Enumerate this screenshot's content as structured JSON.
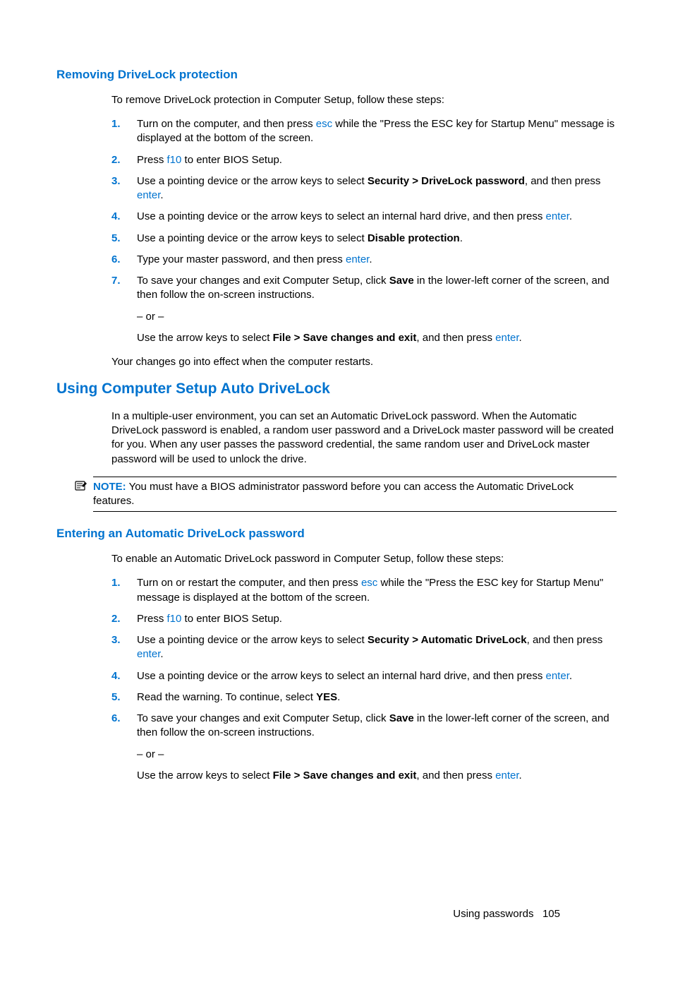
{
  "section1": {
    "heading": "Removing DriveLock protection",
    "intro": "To remove DriveLock protection in Computer Setup, follow these steps:",
    "steps": {
      "s1a": "Turn on the computer, and then press ",
      "s1key": "esc",
      "s1b": " while the \"Press the ESC key for Startup Menu\" message is displayed at the bottom of the screen.",
      "s2a": "Press ",
      "s2key": "f10",
      "s2b": " to enter BIOS Setup.",
      "s3a": "Use a pointing device or the arrow keys to select ",
      "s3bold": "Security > DriveLock password",
      "s3b": ", and then press ",
      "s3key": "enter",
      "s3c": ".",
      "s4a": "Use a pointing device or the arrow keys to select an internal hard drive, and then press ",
      "s4key": "enter",
      "s4b": ".",
      "s5a": "Use a pointing device or the arrow keys to select ",
      "s5bold": "Disable protection",
      "s5b": ".",
      "s6a": "Type your master password, and then press ",
      "s6key": "enter",
      "s6b": ".",
      "s7a": "To save your changes and exit Computer Setup, click ",
      "s7bold": "Save",
      "s7b": " in the lower-left corner of the screen, and then follow the on-screen instructions.",
      "s7or": "– or –",
      "s7c": "Use the arrow keys to select ",
      "s7bold2": "File > Save changes and exit",
      "s7d": ", and then press ",
      "s7key": "enter",
      "s7e": "."
    },
    "outro": "Your changes go into effect when the computer restarts."
  },
  "section2": {
    "heading": "Using Computer Setup Auto DriveLock",
    "intro": "In a multiple-user environment, you can set an Automatic DriveLock password. When the Automatic DriveLock password is enabled, a random user password and a DriveLock master password will be created for you. When any user passes the password credential, the same random user and DriveLock master password will be used to unlock the drive.",
    "note_label": "NOTE:",
    "note_text": "   You must have a BIOS administrator password before you can access the Automatic DriveLock features."
  },
  "section3": {
    "heading": "Entering an Automatic DriveLock password",
    "intro": "To enable an Automatic DriveLock password in Computer Setup, follow these steps:",
    "steps": {
      "s1a": "Turn on or restart the computer, and then press ",
      "s1key": "esc",
      "s1b": " while the \"Press the ESC key for Startup Menu\" message is displayed at the bottom of the screen.",
      "s2a": "Press ",
      "s2key": "f10",
      "s2b": " to enter BIOS Setup.",
      "s3a": "Use a pointing device or the arrow keys to select ",
      "s3bold": "Security > Automatic DriveLock",
      "s3b": ", and then press ",
      "s3key": "enter",
      "s3c": ".",
      "s4a": "Use a pointing device or the arrow keys to select an internal hard drive, and then press ",
      "s4key": "enter",
      "s4b": ".",
      "s5a": "Read the warning. To continue, select ",
      "s5bold": "YES",
      "s5b": ".",
      "s6a": "To save your changes and exit Computer Setup, click ",
      "s6bold": "Save",
      "s6b": " in the lower-left corner of the screen, and then follow the on-screen instructions.",
      "s6or": "– or –",
      "s6c": "Use the arrow keys to select ",
      "s6bold2": "File > Save changes and exit",
      "s6d": ", and then press ",
      "s6key": "enter",
      "s6e": "."
    }
  },
  "nums": {
    "n1": "1.",
    "n2": "2.",
    "n3": "3.",
    "n4": "4.",
    "n5": "5.",
    "n6": "6.",
    "n7": "7."
  },
  "footer": {
    "label": "Using passwords",
    "page": "105"
  }
}
